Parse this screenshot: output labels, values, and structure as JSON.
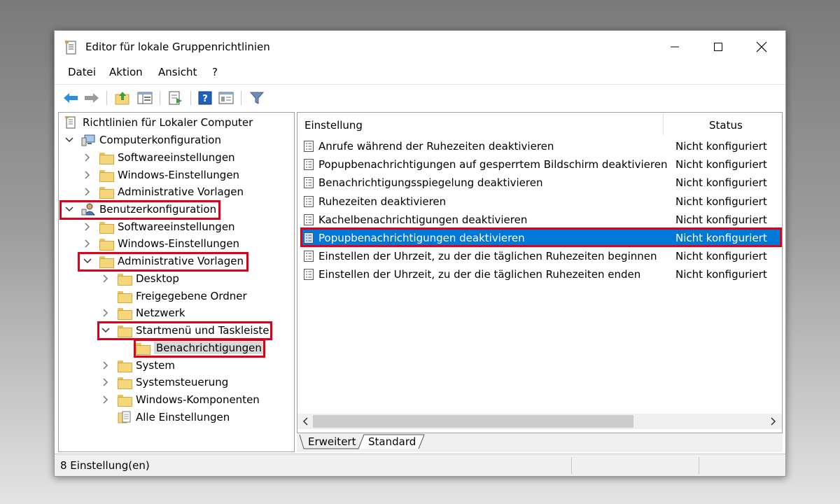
{
  "window": {
    "title": "Editor für lokale Gruppenrichtlinien"
  },
  "menu": [
    "Datei",
    "Aktion",
    "Ansicht",
    "?"
  ],
  "toolbar": {
    "icons": [
      "back-arrow-icon",
      "forward-arrow-icon",
      "up-folder-icon",
      "show-hide-tree-icon",
      "export-list-icon",
      "help-icon",
      "properties-icon",
      "filter-icon"
    ]
  },
  "tree": {
    "root": "Richtlinien für Lokaler Computer",
    "computer": "Computerkonfiguration",
    "computer_children": [
      "Softwareeinstellungen",
      "Windows-Einstellungen",
      "Administrative Vorlagen"
    ],
    "user": "Benutzerkonfiguration",
    "user_children": [
      "Softwareeinstellungen",
      "Windows-Einstellungen",
      "Administrative Vorlagen"
    ],
    "admin_children": [
      "Desktop",
      "Freigegebene Ordner",
      "Netzwerk",
      "Startmenü und Taskleiste"
    ],
    "startmenu_child": "Benachrichtigungen",
    "admin_children_after": [
      "System",
      "Systemsteuerung",
      "Windows-Komponenten"
    ],
    "all_settings": "Alle Einstellungen"
  },
  "list": {
    "columns": [
      "Einstellung",
      "Status"
    ],
    "rows": [
      {
        "name": "Anrufe während der Ruhezeiten deaktivieren",
        "status": "Nicht konfiguriert"
      },
      {
        "name": "Popupbenachrichtigungen auf gesperrtem Bildschirm deaktivieren",
        "status": "Nicht konfiguriert"
      },
      {
        "name": "Benachrichtigungsspiegelung deaktivieren",
        "status": "Nicht konfiguriert"
      },
      {
        "name": "Ruhezeiten deaktivieren",
        "status": "Nicht konfiguriert"
      },
      {
        "name": "Kachelbenachrichtigungen deaktivieren",
        "status": "Nicht konfiguriert"
      },
      {
        "name": "Popupbenachrichtigungen deaktivieren",
        "status": "Nicht konfiguriert"
      },
      {
        "name": "Einstellen der Uhrzeit, zu der die täglichen Ruhezeiten beginnen",
        "status": "Nicht konfiguriert"
      },
      {
        "name": "Einstellen der Uhrzeit, zu der die täglichen Ruhezeiten enden",
        "status": "Nicht konfiguriert"
      }
    ],
    "selected_index": 5
  },
  "tabs": [
    "Erweitert",
    "Standard"
  ],
  "statusbar": {
    "text": "8 Einstellung(en)"
  },
  "colors": {
    "selection": "#0078d7",
    "highlight": "#e1001a",
    "folder": "#f5d67a"
  }
}
